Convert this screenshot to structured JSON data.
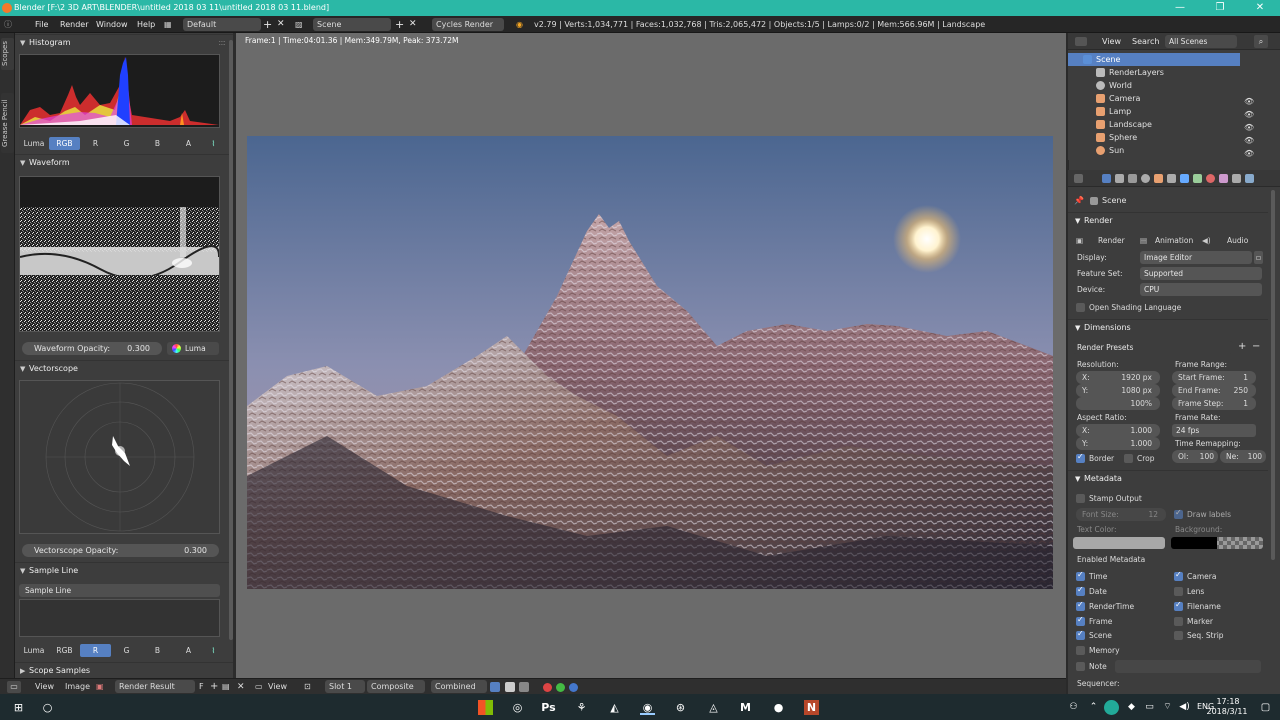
{
  "titlebar": {
    "title": "Blender [F:\\2 3D ART\\BLENDER\\untitled 2018 03 11\\untitled 2018 03 11.blend]",
    "minimize": "—",
    "restore": "❐",
    "close": "✕"
  },
  "infobar": {
    "menus": [
      "File",
      "Render",
      "Window",
      "Help"
    ],
    "layout": "Default",
    "scene": "Scene",
    "engine": "Cycles Render",
    "stats": "v2.79 | Verts:1,034,771 | Faces:1,032,768 | Tris:2,065,472 | Objects:1/5 | Lamps:0/2 | Mem:566.96M | Landscape"
  },
  "left_strip": {
    "tabs": [
      "Scopes",
      "Grease Pencil"
    ]
  },
  "scopes": {
    "histogram": {
      "title": "Histogram",
      "channels": [
        "Luma",
        "RGB",
        "R",
        "G",
        "B",
        "A"
      ],
      "selected": "RGB"
    },
    "waveform": {
      "title": "Waveform",
      "opacity_label": "Waveform Opacity:",
      "opacity_value": "0.300",
      "mode": "Luma"
    },
    "vectorscope": {
      "title": "Vectorscope",
      "opacity_label": "Vectorscope Opacity:",
      "opacity_value": "0.300"
    },
    "sample_line": {
      "title": "Sample Line",
      "button": "Sample Line",
      "channels": [
        "Luma",
        "RGB",
        "R",
        "G",
        "B",
        "A"
      ],
      "selected": "R"
    },
    "scope_samples": {
      "title": "Scope Samples"
    }
  },
  "viewport": {
    "info": "Frame:1 | Time:04:01.36 | Mem:349.79M, Peak: 373.72M"
  },
  "bottombar": {
    "view": "View",
    "image": "Image",
    "image_name": "Render Result",
    "f": "F",
    "view2": "View",
    "slot": "Slot 1",
    "composite": "Composite",
    "combined": "Combined"
  },
  "outliner": {
    "header": {
      "view": "View",
      "search": "Search",
      "filter": "All Scenes"
    },
    "items": [
      {
        "label": "Scene",
        "color": "#5b8fd6"
      },
      {
        "label": "RenderLayers",
        "color": "#bbbbbb"
      },
      {
        "label": "World",
        "color": "#bbbbbb"
      },
      {
        "label": "Camera",
        "color": "#e8a070"
      },
      {
        "label": "Lamp",
        "color": "#e8a070"
      },
      {
        "label": "Landscape",
        "color": "#e8a070"
      },
      {
        "label": "Sphere",
        "color": "#e8a070"
      },
      {
        "label": "Sun",
        "color": "#e8a070"
      }
    ]
  },
  "properties": {
    "context": "Scene",
    "render": {
      "title": "Render",
      "buttons": [
        "Render",
        "Animation",
        "Audio"
      ],
      "display_label": "Display:",
      "display_value": "Image Editor",
      "featureset_label": "Feature Set:",
      "featureset_value": "Supported",
      "device_label": "Device:",
      "device_value": "CPU",
      "osl": "Open Shading Language"
    },
    "dimensions": {
      "title": "Dimensions",
      "presets": "Render Presets",
      "resolution": "Resolution:",
      "res_x_label": "X:",
      "res_x": "1920 px",
      "res_y_label": "Y:",
      "res_y": "1080 px",
      "res_pct": "100%",
      "frame_range": "Frame Range:",
      "start_label": "Start Frame:",
      "start": "1",
      "end_label": "End Frame:",
      "end": "250",
      "step_label": "Frame Step:",
      "step": "1",
      "aspect": "Aspect Ratio:",
      "asp_x_label": "X:",
      "asp_x": "1.000",
      "asp_y_label": "Y:",
      "asp_y": "1.000",
      "frame_rate": "Frame Rate:",
      "fps": "24 fps",
      "time_remap": "Time Remapping:",
      "old_label": "Ol:",
      "old": "100",
      "new_label": "Ne:",
      "new": "100",
      "border": "Border",
      "crop": "Crop"
    },
    "metadata": {
      "title": "Metadata",
      "stamp": "Stamp Output",
      "font_size_label": "Font Size:",
      "font_size": "12",
      "draw_labels": "Draw labels",
      "text_color": "Text Color:",
      "background": "Background:",
      "enabled": "Enabled Metadata",
      "left": [
        {
          "label": "Time",
          "on": true
        },
        {
          "label": "Date",
          "on": true
        },
        {
          "label": "RenderTime",
          "on": true
        },
        {
          "label": "Frame",
          "on": true
        },
        {
          "label": "Scene",
          "on": true
        },
        {
          "label": "Memory",
          "on": false
        },
        {
          "label": "Note",
          "on": false
        }
      ],
      "right": [
        {
          "label": "Camera",
          "on": true
        },
        {
          "label": "Lens",
          "on": false
        },
        {
          "label": "Filename",
          "on": true
        },
        {
          "label": "Marker",
          "on": false
        },
        {
          "label": "Seq. Strip",
          "on": false
        }
      ],
      "sequencer": "Sequencer:"
    }
  },
  "taskbar": {
    "lang": "ENG",
    "time": "17:18",
    "date": "2018/3/11",
    "apps": [
      "Ps",
      "M",
      "N"
    ]
  }
}
